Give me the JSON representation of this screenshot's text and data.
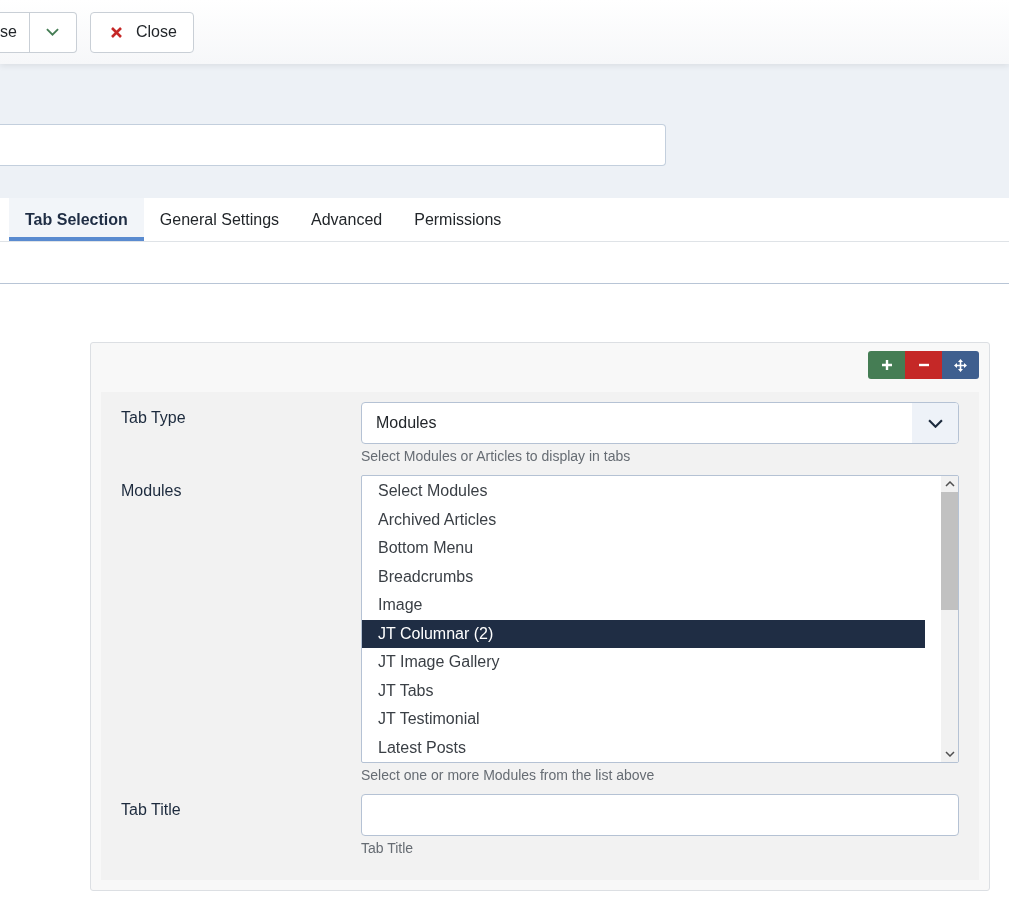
{
  "toolbar": {
    "buttons": [
      {
        "kind": "split",
        "label": "se"
      },
      {
        "kind": "close",
        "label": "Close"
      }
    ]
  },
  "tabs": [
    {
      "label": "Tab Selection",
      "selected": true
    },
    {
      "label": "General Settings",
      "selected": false
    },
    {
      "label": "Advanced",
      "selected": false
    },
    {
      "label": "Permissions",
      "selected": false
    }
  ],
  "panel": {
    "row_buttons": [
      {
        "kind": "add"
      },
      {
        "kind": "remove"
      },
      {
        "kind": "move"
      }
    ],
    "fields": [
      {
        "kind": "select",
        "label": "Tab Type",
        "value": "Modules",
        "help": "Select Modules or Articles to display in tabs"
      },
      {
        "kind": "listbox",
        "label": "Modules",
        "help": "Select one or more Modules from the list above",
        "options": [
          {
            "label": "Select Modules",
            "selected": false
          },
          {
            "label": "Archived Articles",
            "selected": false
          },
          {
            "label": "Bottom Menu",
            "selected": false
          },
          {
            "label": "Breadcrumbs",
            "selected": false
          },
          {
            "label": "Image",
            "selected": false
          },
          {
            "label": "JT Columnar (2)",
            "selected": true
          },
          {
            "label": "JT Image Gallery",
            "selected": false
          },
          {
            "label": "JT Tabs",
            "selected": false
          },
          {
            "label": "JT Testimonial",
            "selected": false
          },
          {
            "label": "Latest Posts",
            "selected": false
          }
        ]
      },
      {
        "kind": "text",
        "label": "Tab Title",
        "help": "Tab Title"
      }
    ]
  }
}
